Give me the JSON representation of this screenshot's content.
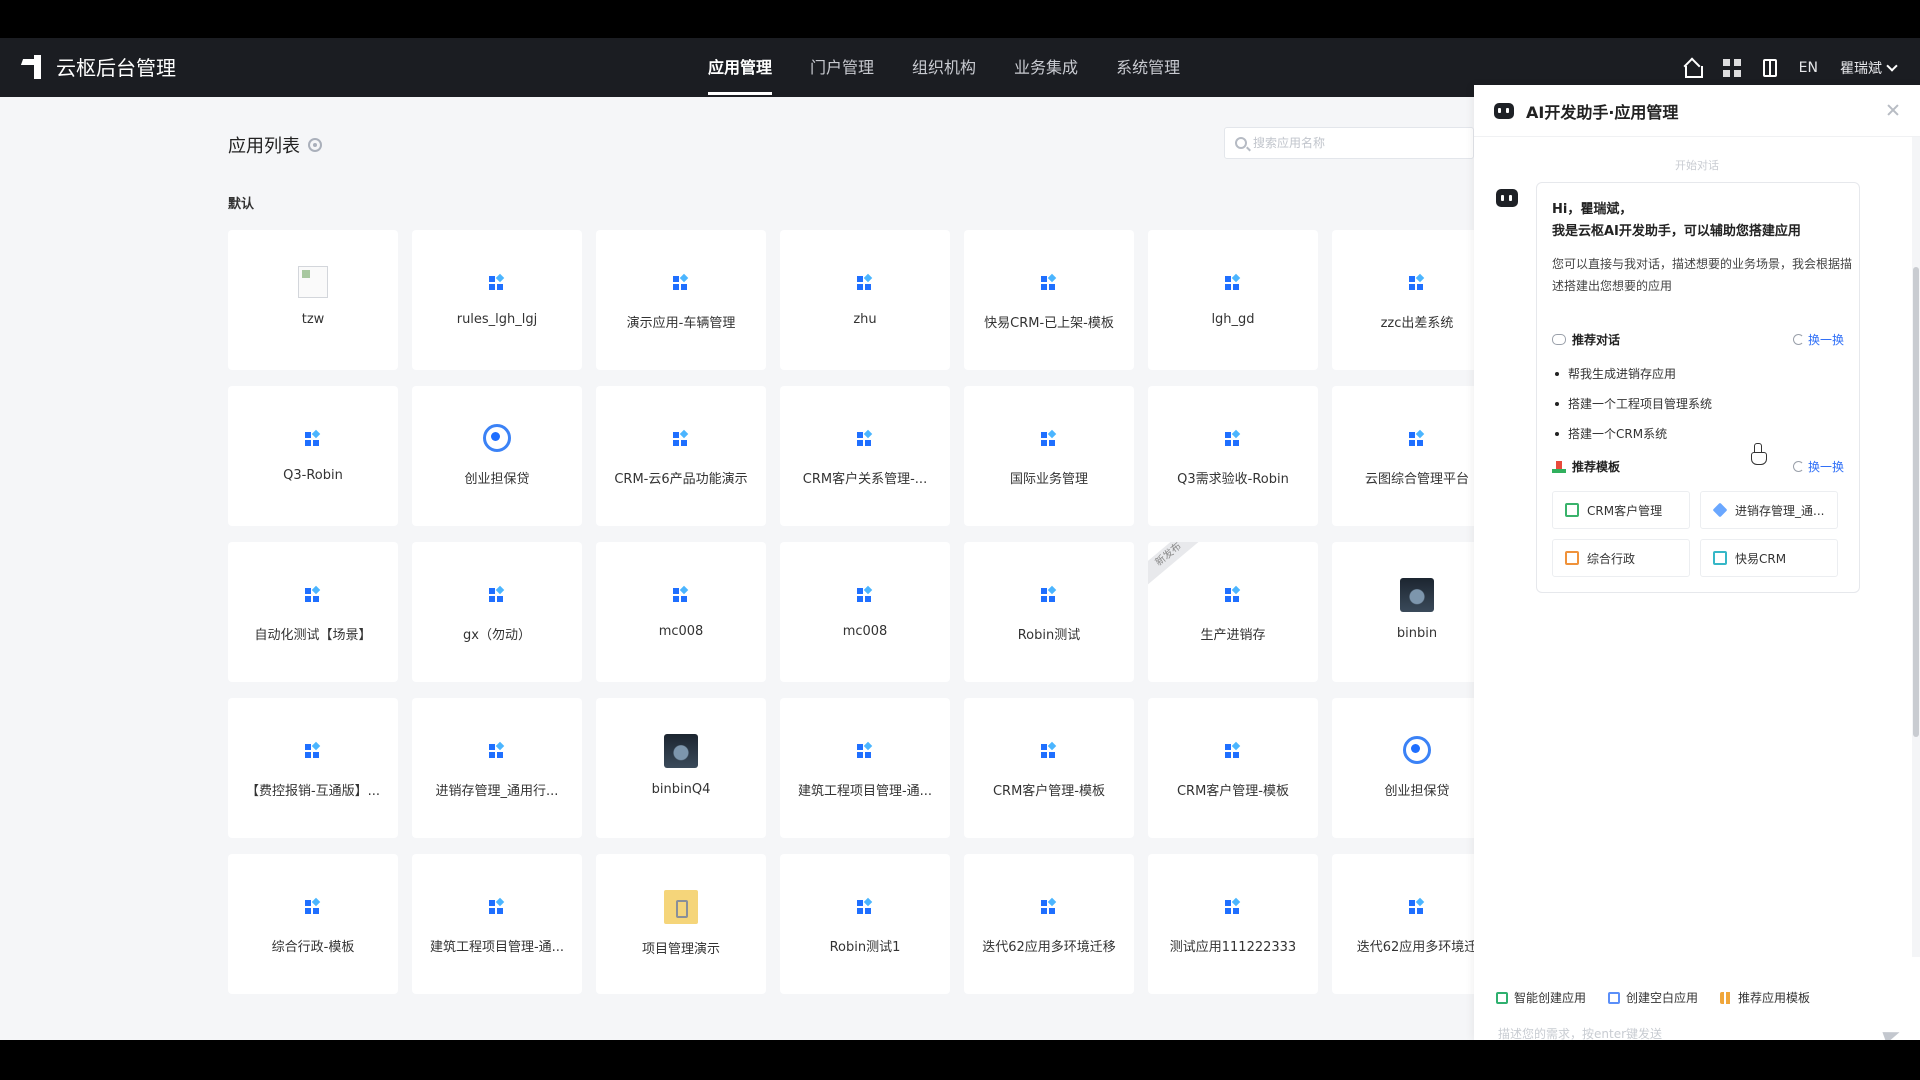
{
  "brand": {
    "title": "云枢后台管理"
  },
  "nav": {
    "items": [
      {
        "label": "应用管理",
        "active": true
      },
      {
        "label": "门户管理",
        "active": false
      },
      {
        "label": "组织机构",
        "active": false
      },
      {
        "label": "业务集成",
        "active": false
      },
      {
        "label": "系统管理",
        "active": false
      }
    ]
  },
  "topbar": {
    "lang": "EN",
    "user": "瞿瑞斌",
    "icons": [
      "home-icon",
      "apps-icon",
      "book-icon"
    ]
  },
  "main": {
    "title": "应用列表",
    "search_placeholder": "搜索应用名称",
    "group": "默认",
    "ribbon": "新发布",
    "apps": [
      {
        "name": "tzw",
        "icon": "broken-image"
      },
      {
        "name": "rules_lgh_lgj",
        "icon": "grid"
      },
      {
        "name": "演示应用-车辆管理",
        "icon": "grid"
      },
      {
        "name": "zhu",
        "icon": "grid"
      },
      {
        "name": "快易CRM-已上架-模板",
        "icon": "grid"
      },
      {
        "name": "lgh_gd",
        "icon": "grid"
      },
      {
        "name": "zzc出差系统",
        "icon": "grid"
      },
      {
        "name": "Q3-Robin",
        "icon": "grid"
      },
      {
        "name": "创业担保贷",
        "icon": "ring"
      },
      {
        "name": "CRM-云6产品功能演示",
        "icon": "grid"
      },
      {
        "name": "CRM客户关系管理-...",
        "icon": "grid"
      },
      {
        "name": "国际业务管理",
        "icon": "grid"
      },
      {
        "name": "Q3需求验收-Robin",
        "icon": "grid"
      },
      {
        "name": "云图综合管理平台",
        "icon": "grid"
      },
      {
        "name": "自动化测试【场景】",
        "icon": "grid"
      },
      {
        "name": "gx（勿动）",
        "icon": "grid"
      },
      {
        "name": "mc008",
        "icon": "grid"
      },
      {
        "name": "mc008",
        "icon": "grid"
      },
      {
        "name": "Robin测试",
        "icon": "grid"
      },
      {
        "name": "生产进销存",
        "icon": "grid",
        "ribbon": true
      },
      {
        "name": "binbin",
        "icon": "photo"
      },
      {
        "name": "【费控报销-互通版】...",
        "icon": "grid"
      },
      {
        "name": "进销存管理_通用行...",
        "icon": "grid"
      },
      {
        "name": "binbinQ4",
        "icon": "photo"
      },
      {
        "name": "建筑工程项目管理-通...",
        "icon": "grid"
      },
      {
        "name": "CRM客户管理-模板",
        "icon": "grid"
      },
      {
        "name": "CRM客户管理-模板",
        "icon": "grid"
      },
      {
        "name": "创业担保贷",
        "icon": "ring"
      },
      {
        "name": "综合行政-模板",
        "icon": "grid"
      },
      {
        "name": "建筑工程项目管理-通...",
        "icon": "grid"
      },
      {
        "name": "项目管理演示",
        "icon": "doc"
      },
      {
        "name": "Robin测试1",
        "icon": "grid"
      },
      {
        "name": "迭代62应用多环境迁移",
        "icon": "grid"
      },
      {
        "name": "测试应用111222333",
        "icon": "grid"
      },
      {
        "name": "迭代62应用多环境迁",
        "icon": "grid"
      }
    ]
  },
  "ai": {
    "title": "AI开发助手·应用管理",
    "start_label": "开始对话",
    "greeting": "Hi，瞿瑞斌，",
    "intro": "我是云枢AI开发助手，可以辅助您搭建应用",
    "desc": "您可以直接与我对话，描述想要的业务场景，我会根据描述搭建出您想要的应用",
    "rec_chat_title": "推荐对话",
    "refresh_label": "换一换",
    "rec_chats": [
      "帮我生成进销存应用",
      "搭建一个工程项目管理系统",
      "搭建一个CRM系统"
    ],
    "rec_tpl_title": "推荐模板",
    "templates": [
      {
        "label": "CRM客户管理",
        "color": "#39b26b"
      },
      {
        "label": "进销存管理_通...",
        "color": "#6aa7ff"
      },
      {
        "label": "综合行政",
        "color": "#f0923a"
      },
      {
        "label": "快易CRM",
        "color": "#36b7c7"
      }
    ],
    "actions": [
      "智能创建应用",
      "创建空白应用",
      "推荐应用模板"
    ],
    "input_placeholder": "描述您的需求，按enter键发送"
  }
}
